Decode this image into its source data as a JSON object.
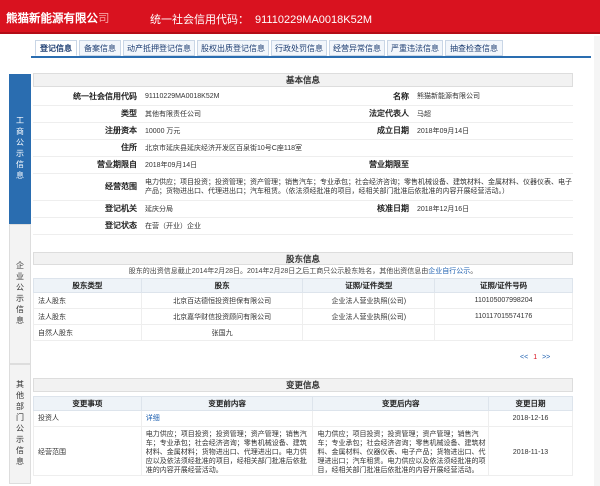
{
  "header": {
    "company_main": "熊猫新能源有限公",
    "company_accent": "司",
    "code_label": "统一社会信用代码：",
    "code_value": "91110229MA0018K52M"
  },
  "sidebar": [
    {
      "label": "工商公示信息"
    },
    {
      "label": "企业公示信息"
    },
    {
      "label": "其他部门公示信息"
    }
  ],
  "tabs": [
    {
      "label": "登记信息"
    },
    {
      "label": "备案信息"
    },
    {
      "label": "动产抵押登记信息"
    },
    {
      "label": "股权出质登记信息"
    },
    {
      "label": "行政处罚信息"
    },
    {
      "label": "经营异常信息"
    },
    {
      "label": "严重违法信息"
    },
    {
      "label": "抽查检查信息"
    }
  ],
  "basic": {
    "title": "基本信息",
    "rows": [
      {
        "l1": "统一社会信用代码",
        "v1": "91110229MA0018K52M",
        "l2": "名称",
        "v2": "熊猫新能源有限公司"
      },
      {
        "l1": "类型",
        "v1": "其他有限责任公司",
        "l2": "法定代表人",
        "v2": "马超"
      },
      {
        "l1": "注册资本",
        "v1": "10000 万元",
        "l2": "成立日期",
        "v2": "2018年09月14日"
      },
      {
        "l1": "住所",
        "v1": "北京市延庆县延庆经济开发区百泉街10号C座118室",
        "l2": "",
        "v2": ""
      },
      {
        "l1": "营业期限自",
        "v1": "2018年09月14日",
        "l2": "营业期限至",
        "v2": ""
      },
      {
        "l1": "经营范围",
        "v1": "电力供应；项目投资；投资管理；资产管理；销售汽车；专业承包；社会经济咨询；零售机械设备、建筑材料、金属材料、仪器仪表、电子产品；货物进出口、代理进出口；汽车租赁。（依法须经批准的项目，经相关部门批准后依批准的内容开展经营活动。）",
        "l2": "",
        "v2": ""
      },
      {
        "l1": "登记机关",
        "v1": "延庆分局",
        "l2": "核准日期",
        "v2": "2018年12月16日"
      },
      {
        "l1": "登记状态",
        "v1": "在营（开业）企业",
        "l2": "",
        "v2": ""
      }
    ]
  },
  "shareholders": {
    "title": "股东信息",
    "note_prefix": "股东的出资信息截止2014年2月28日。2014年2月28日之后工商只公示股东姓名，其他出资信息由",
    "note_link": "企业自行公示",
    "note_suffix": "。",
    "columns": [
      "股东类型",
      "股东",
      "证照/证件类型",
      "证照/证件号码"
    ],
    "rows": [
      {
        "type": "法人股东",
        "name": "北京百达德恒投资担保有限公司",
        "cert_type": "企业法人营业执照(公司)",
        "cert_no": "110105007998204"
      },
      {
        "type": "法人股东",
        "name": "北京嘉华财信投资顾问有限公司",
        "cert_type": "企业法人营业执照(公司)",
        "cert_no": "110117015574176"
      },
      {
        "type": "自然人股东",
        "name": "张国九",
        "cert_type": "",
        "cert_no": ""
      }
    ],
    "pager": {
      "prev": "<<",
      "page": "1",
      "next": ">>"
    }
  },
  "changes": {
    "title": "变更信息",
    "columns": [
      "变更事项",
      "变更前内容",
      "变更后内容",
      "变更日期"
    ],
    "rows": [
      {
        "item": "投资人",
        "before": "详细",
        "after": "",
        "date": "2018-12-16"
      },
      {
        "item": "经营范围",
        "before": "电力供应；项目投资；投资管理；资产管理；销售汽车；专业承包；社会经济咨询；零售机械设备、建筑材料、金属材料；货物进出口、代理进出口。电力供应以及依法须经批准的项目，经相关部门批准后依批准的内容开展经营活动。",
        "after": "电力供应；项目投资；投资管理；资产管理；销售汽车；专业承包；社会经济咨询；零售机械设备、建筑材料、金属材料、仪器仪表、电子产品；货物进出口、代理进出口；汽车租赁。电力供应以及依法须经批准的项目，经相关部门批准后依批准的内容开展经营活动。",
        "date": "2018-11-13"
      }
    ]
  }
}
